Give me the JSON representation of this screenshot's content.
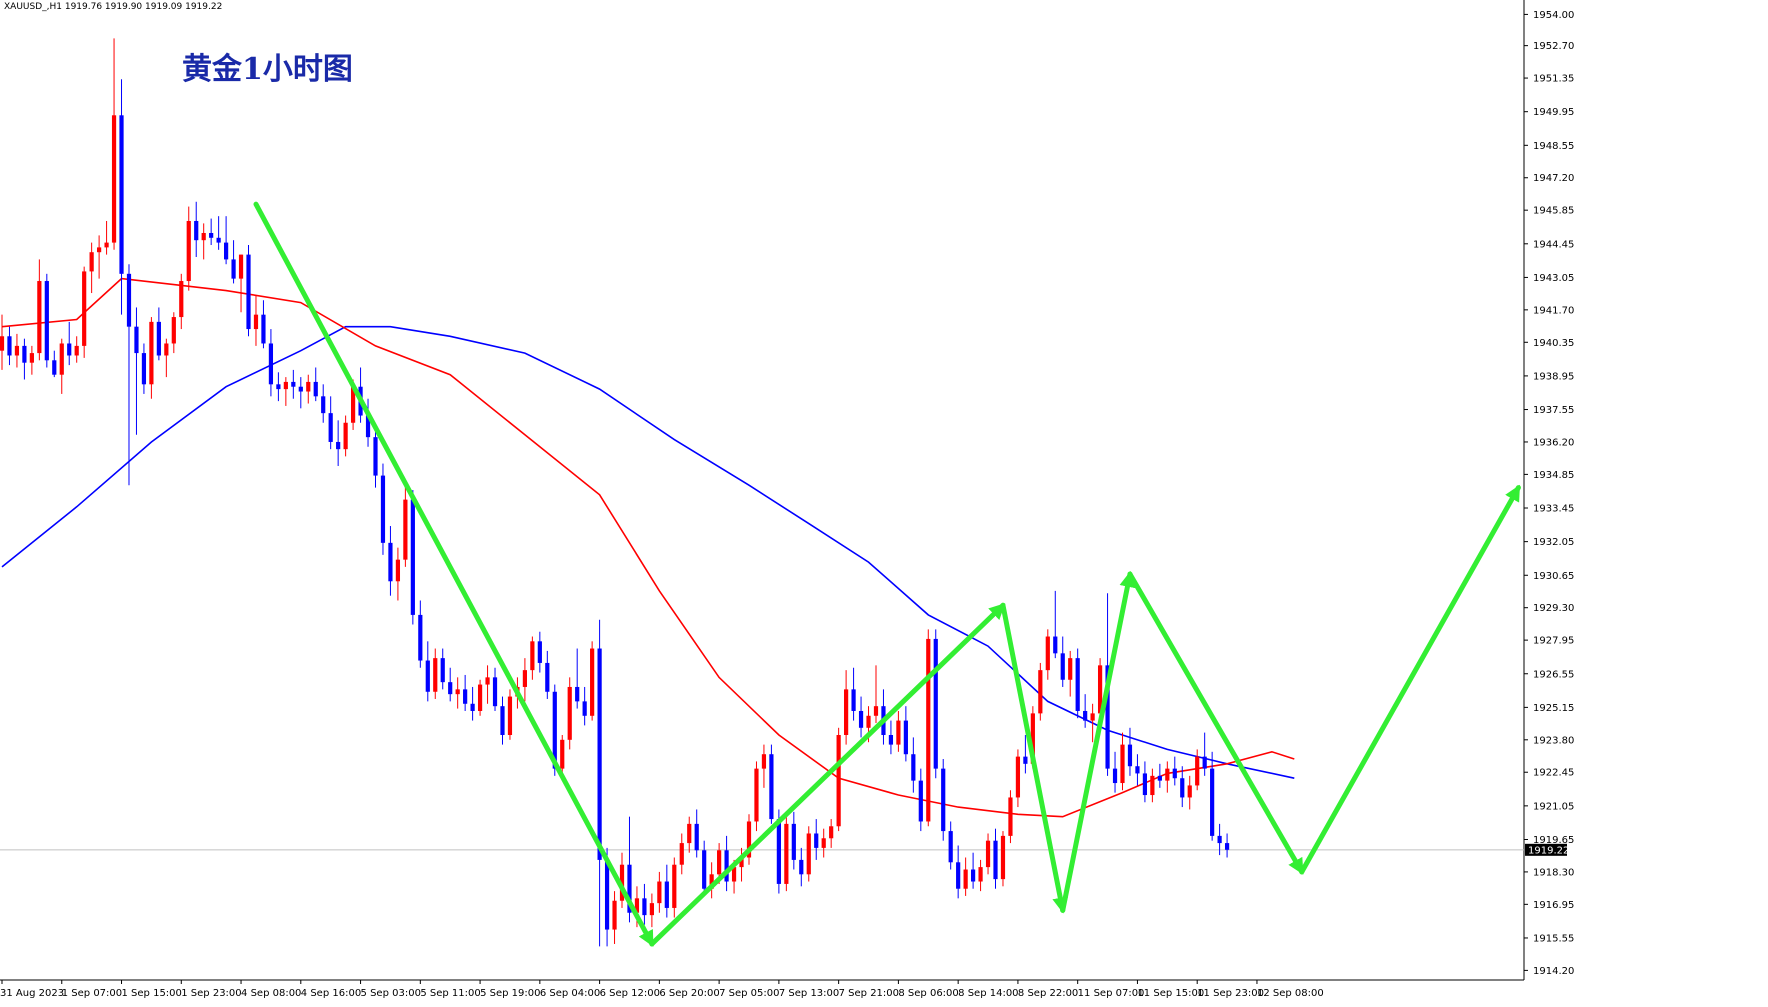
{
  "header": {
    "symbol_info": "XAUUSD_,H1  1919.76 1919.90 1919.09 1919.22"
  },
  "title": "黄金1小时图",
  "colors": {
    "bull": "#ff0000",
    "bear": "#0000ff",
    "ma_fast": "#ff0000",
    "ma_slow": "#0000ff",
    "arrows": "#33ee33",
    "price_line": "#c0c0c0",
    "title": "#1a2aa8"
  },
  "current_price_label": "1919.22",
  "chart_data": {
    "type": "candlestick",
    "symbol": "XAUUSD_",
    "timeframe": "H1",
    "ylim": [
      1913.8,
      1954.6
    ],
    "current_price": 1919.22,
    "y_ticks": [
      "1954.00",
      "1952.70",
      "1951.35",
      "1949.95",
      "1948.55",
      "1947.20",
      "1945.85",
      "1944.45",
      "1943.05",
      "1941.70",
      "1940.35",
      "1938.95",
      "1937.55",
      "1936.20",
      "1934.85",
      "1933.45",
      "1932.05",
      "1930.65",
      "1929.30",
      "1927.95",
      "1926.55",
      "1925.15",
      "1923.80",
      "1922.45",
      "1921.05",
      "1919.65",
      "1918.30",
      "1916.95",
      "1915.55",
      "1914.20"
    ],
    "x_ticks": [
      {
        "label": "31 Aug 2023",
        "index": 0
      },
      {
        "label": "1 Sep 07:00",
        "index": 8
      },
      {
        "label": "1 Sep 15:00",
        "index": 16
      },
      {
        "label": "1 Sep 23:00",
        "index": 24
      },
      {
        "label": "4 Sep 08:00",
        "index": 32
      },
      {
        "label": "4 Sep 16:00",
        "index": 40
      },
      {
        "label": "5 Sep 03:00",
        "index": 48
      },
      {
        "label": "5 Sep 11:00",
        "index": 56
      },
      {
        "label": "5 Sep 19:00",
        "index": 64
      },
      {
        "label": "6 Sep 04:00",
        "index": 72
      },
      {
        "label": "6 Sep 12:00",
        "index": 80
      },
      {
        "label": "6 Sep 20:00",
        "index": 88
      },
      {
        "label": "7 Sep 05:00",
        "index": 96
      },
      {
        "label": "7 Sep 13:00",
        "index": 104
      },
      {
        "label": "7 Sep 21:00",
        "index": 112
      },
      {
        "label": "8 Sep 06:00",
        "index": 120
      },
      {
        "label": "8 Sep 14:00",
        "index": 128
      },
      {
        "label": "8 Sep 22:00",
        "index": 136
      },
      {
        "label": "11 Sep 07:00",
        "index": 144
      },
      {
        "label": "11 Sep 15:00",
        "index": 152
      },
      {
        "label": "11 Sep 23:00",
        "index": 160
      },
      {
        "label": "12 Sep 08:00",
        "index": 168
      }
    ],
    "ohlc": [
      [
        1940.0,
        1941.5,
        1939.2,
        1940.6
      ],
      [
        1940.6,
        1941.0,
        1939.4,
        1939.8
      ],
      [
        1939.8,
        1940.7,
        1939.3,
        1940.2
      ],
      [
        1940.2,
        1940.5,
        1938.8,
        1939.5
      ],
      [
        1939.5,
        1940.2,
        1939.0,
        1939.9
      ],
      [
        1939.9,
        1943.8,
        1939.6,
        1942.9
      ],
      [
        1942.9,
        1943.2,
        1939.3,
        1939.6
      ],
      [
        1939.6,
        1940.0,
        1938.9,
        1939.0
      ],
      [
        1939.0,
        1940.5,
        1938.2,
        1940.3
      ],
      [
        1940.3,
        1941.2,
        1939.4,
        1939.8
      ],
      [
        1939.8,
        1940.6,
        1939.5,
        1940.2
      ],
      [
        1940.2,
        1943.5,
        1939.7,
        1943.3
      ],
      [
        1943.3,
        1944.5,
        1942.4,
        1944.1
      ],
      [
        1944.1,
        1944.8,
        1943.0,
        1944.3
      ],
      [
        1944.3,
        1945.4,
        1944.0,
        1944.5
      ],
      [
        1944.5,
        1953.0,
        1944.2,
        1949.8
      ],
      [
        1949.8,
        1951.3,
        1941.5,
        1943.2
      ],
      [
        1943.2,
        1943.6,
        1934.4,
        1941.0
      ],
      [
        1941.0,
        1941.8,
        1936.5,
        1939.9
      ],
      [
        1939.9,
        1940.3,
        1938.2,
        1938.6
      ],
      [
        1938.6,
        1941.4,
        1938.0,
        1941.2
      ],
      [
        1941.2,
        1941.8,
        1939.6,
        1939.8
      ],
      [
        1939.8,
        1940.5,
        1938.9,
        1940.3
      ],
      [
        1940.3,
        1941.6,
        1939.9,
        1941.4
      ],
      [
        1941.4,
        1943.2,
        1940.9,
        1942.9
      ],
      [
        1942.9,
        1946.0,
        1942.5,
        1945.4
      ],
      [
        1945.4,
        1946.2,
        1943.9,
        1944.6
      ],
      [
        1944.6,
        1945.3,
        1943.8,
        1944.9
      ],
      [
        1944.9,
        1945.5,
        1944.4,
        1944.7
      ],
      [
        1944.7,
        1945.6,
        1944.2,
        1944.5
      ],
      [
        1944.5,
        1945.6,
        1943.6,
        1943.8
      ],
      [
        1943.8,
        1944.6,
        1942.8,
        1943.0
      ],
      [
        1943.0,
        1944.0,
        1941.6,
        1944.0
      ],
      [
        1944.0,
        1944.4,
        1940.6,
        1940.9
      ],
      [
        1940.9,
        1942.3,
        1940.2,
        1941.5
      ],
      [
        1941.5,
        1942.1,
        1940.1,
        1940.3
      ],
      [
        1940.3,
        1940.9,
        1938.1,
        1938.6
      ],
      [
        1938.6,
        1939.1,
        1937.9,
        1938.4
      ],
      [
        1938.4,
        1938.9,
        1937.7,
        1938.7
      ],
      [
        1938.7,
        1939.2,
        1938.0,
        1938.5
      ],
      [
        1938.5,
        1938.9,
        1937.6,
        1938.3
      ],
      [
        1938.3,
        1939.0,
        1937.8,
        1938.7
      ],
      [
        1938.7,
        1939.3,
        1937.9,
        1938.1
      ],
      [
        1938.1,
        1938.6,
        1937.0,
        1937.4
      ],
      [
        1937.4,
        1938.1,
        1935.9,
        1936.2
      ],
      [
        1936.2,
        1937.1,
        1935.2,
        1935.9
      ],
      [
        1935.9,
        1937.3,
        1935.6,
        1937.0
      ],
      [
        1937.0,
        1938.8,
        1936.7,
        1938.5
      ],
      [
        1938.5,
        1939.3,
        1937.0,
        1937.3
      ],
      [
        1937.3,
        1938.0,
        1936.0,
        1936.4
      ],
      [
        1936.4,
        1936.9,
        1934.3,
        1934.8
      ],
      [
        1934.8,
        1935.3,
        1931.5,
        1932.0
      ],
      [
        1932.0,
        1932.7,
        1929.8,
        1930.4
      ],
      [
        1930.4,
        1931.8,
        1929.6,
        1931.3
      ],
      [
        1931.3,
        1934.4,
        1931.0,
        1933.8
      ],
      [
        1933.8,
        1934.2,
        1928.6,
        1929.0
      ],
      [
        1929.0,
        1929.6,
        1926.8,
        1927.1
      ],
      [
        1927.1,
        1927.9,
        1925.4,
        1925.8
      ],
      [
        1925.8,
        1927.6,
        1925.5,
        1927.2
      ],
      [
        1927.2,
        1927.6,
        1925.9,
        1926.2
      ],
      [
        1926.2,
        1926.8,
        1925.4,
        1925.7
      ],
      [
        1925.7,
        1926.4,
        1925.1,
        1925.9
      ],
      [
        1925.9,
        1926.5,
        1925.0,
        1925.3
      ],
      [
        1925.3,
        1926.0,
        1924.6,
        1925.0
      ],
      [
        1925.0,
        1926.3,
        1924.8,
        1926.1
      ],
      [
        1926.1,
        1926.9,
        1925.3,
        1926.4
      ],
      [
        1926.4,
        1926.8,
        1925.0,
        1925.2
      ],
      [
        1925.2,
        1925.6,
        1923.6,
        1924.0
      ],
      [
        1924.0,
        1925.9,
        1923.8,
        1925.6
      ],
      [
        1925.6,
        1926.4,
        1925.1,
        1926.0
      ],
      [
        1926.0,
        1927.2,
        1925.4,
        1926.7
      ],
      [
        1926.7,
        1928.1,
        1926.3,
        1927.9
      ],
      [
        1927.9,
        1928.3,
        1926.6,
        1927.0
      ],
      [
        1927.0,
        1927.5,
        1925.5,
        1925.8
      ],
      [
        1925.8,
        1926.1,
        1922.3,
        1922.6
      ],
      [
        1922.6,
        1924.0,
        1922.1,
        1923.8
      ],
      [
        1923.8,
        1926.4,
        1923.4,
        1926.0
      ],
      [
        1926.0,
        1927.6,
        1925.1,
        1925.4
      ],
      [
        1925.4,
        1926.0,
        1924.4,
        1924.8
      ],
      [
        1924.8,
        1927.9,
        1924.6,
        1927.6
      ],
      [
        1927.6,
        1928.8,
        1915.2,
        1918.8
      ],
      [
        1918.8,
        1919.3,
        1915.2,
        1915.9
      ],
      [
        1915.9,
        1917.5,
        1915.3,
        1917.1
      ],
      [
        1917.1,
        1919.1,
        1916.8,
        1918.6
      ],
      [
        1918.6,
        1920.6,
        1916.2,
        1916.6
      ],
      [
        1916.6,
        1917.7,
        1916.0,
        1917.2
      ],
      [
        1917.2,
        1917.8,
        1916.1,
        1916.5
      ],
      [
        1916.5,
        1917.4,
        1916.0,
        1917.0
      ],
      [
        1917.0,
        1918.3,
        1916.6,
        1917.9
      ],
      [
        1917.9,
        1918.6,
        1916.4,
        1916.8
      ],
      [
        1916.8,
        1918.9,
        1916.4,
        1918.6
      ],
      [
        1918.6,
        1919.9,
        1918.2,
        1919.5
      ],
      [
        1919.5,
        1920.6,
        1919.1,
        1920.3
      ],
      [
        1920.3,
        1920.9,
        1918.9,
        1919.2
      ],
      [
        1919.2,
        1919.6,
        1917.3,
        1917.6
      ],
      [
        1917.6,
        1918.7,
        1917.2,
        1918.2
      ],
      [
        1918.2,
        1919.5,
        1917.8,
        1919.2
      ],
      [
        1919.2,
        1919.8,
        1917.5,
        1917.9
      ],
      [
        1917.9,
        1918.8,
        1917.4,
        1918.5
      ],
      [
        1918.5,
        1919.3,
        1917.9,
        1918.9
      ],
      [
        1918.9,
        1920.7,
        1918.6,
        1920.4
      ],
      [
        1920.4,
        1922.9,
        1920.0,
        1922.6
      ],
      [
        1922.6,
        1923.6,
        1921.8,
        1923.2
      ],
      [
        1923.2,
        1923.6,
        1920.3,
        1920.5
      ],
      [
        1920.5,
        1920.9,
        1917.4,
        1917.8
      ],
      [
        1917.8,
        1920.6,
        1917.5,
        1920.3
      ],
      [
        1920.3,
        1920.8,
        1918.4,
        1918.8
      ],
      [
        1918.8,
        1919.3,
        1917.7,
        1918.2
      ],
      [
        1918.2,
        1920.2,
        1917.9,
        1919.9
      ],
      [
        1919.9,
        1920.5,
        1918.8,
        1919.3
      ],
      [
        1919.3,
        1920.1,
        1918.9,
        1919.7
      ],
      [
        1919.7,
        1920.5,
        1919.3,
        1920.2
      ],
      [
        1920.2,
        1924.3,
        1920.0,
        1924.0
      ],
      [
        1924.0,
        1926.7,
        1923.6,
        1925.9
      ],
      [
        1925.9,
        1926.8,
        1924.6,
        1925.0
      ],
      [
        1925.0,
        1925.6,
        1923.9,
        1924.3
      ],
      [
        1924.3,
        1925.2,
        1923.7,
        1924.8
      ],
      [
        1924.8,
        1926.9,
        1924.5,
        1925.2
      ],
      [
        1925.2,
        1925.9,
        1923.6,
        1924.0
      ],
      [
        1924.0,
        1924.6,
        1923.2,
        1923.6
      ],
      [
        1923.6,
        1925.0,
        1923.3,
        1924.6
      ],
      [
        1924.6,
        1925.2,
        1922.9,
        1923.2
      ],
      [
        1923.2,
        1923.9,
        1921.6,
        1922.1
      ],
      [
        1922.1,
        1922.6,
        1920.0,
        1920.4
      ],
      [
        1920.4,
        1928.4,
        1920.2,
        1928.0
      ],
      [
        1928.0,
        1928.4,
        1922.2,
        1922.6
      ],
      [
        1922.6,
        1923.0,
        1919.6,
        1920.0
      ],
      [
        1920.0,
        1920.4,
        1918.4,
        1918.7
      ],
      [
        1918.7,
        1919.4,
        1917.2,
        1917.6
      ],
      [
        1917.6,
        1918.9,
        1917.3,
        1918.4
      ],
      [
        1918.4,
        1919.1,
        1917.6,
        1917.9
      ],
      [
        1917.9,
        1918.8,
        1917.5,
        1918.5
      ],
      [
        1918.5,
        1919.9,
        1918.2,
        1919.6
      ],
      [
        1919.6,
        1920.1,
        1917.6,
        1918.0
      ],
      [
        1918.0,
        1920.0,
        1917.7,
        1919.8
      ],
      [
        1919.8,
        1921.7,
        1919.5,
        1921.4
      ],
      [
        1921.4,
        1923.4,
        1921.0,
        1923.1
      ],
      [
        1923.1,
        1924.0,
        1922.4,
        1922.8
      ],
      [
        1922.8,
        1925.2,
        1922.6,
        1924.9
      ],
      [
        1924.9,
        1927.0,
        1924.6,
        1926.7
      ],
      [
        1926.7,
        1928.4,
        1926.3,
        1928.1
      ],
      [
        1928.1,
        1930.0,
        1927.2,
        1927.4
      ],
      [
        1927.4,
        1928.1,
        1926.0,
        1926.3
      ],
      [
        1926.3,
        1927.5,
        1925.6,
        1927.2
      ],
      [
        1927.2,
        1927.6,
        1924.7,
        1925.0
      ],
      [
        1925.0,
        1925.7,
        1924.3,
        1924.6
      ],
      [
        1924.6,
        1925.3,
        1923.7,
        1924.9
      ],
      [
        1924.9,
        1927.2,
        1924.6,
        1926.9
      ],
      [
        1926.9,
        1929.9,
        1922.3,
        1922.6
      ],
      [
        1922.6,
        1923.3,
        1921.6,
        1922.0
      ],
      [
        1922.0,
        1924.1,
        1921.7,
        1923.6
      ],
      [
        1923.6,
        1924.3,
        1922.3,
        1922.7
      ],
      [
        1922.7,
        1923.2,
        1921.9,
        1922.4
      ],
      [
        1922.4,
        1922.9,
        1921.2,
        1921.5
      ],
      [
        1921.5,
        1922.6,
        1921.2,
        1922.3
      ],
      [
        1922.3,
        1922.8,
        1921.8,
        1922.1
      ],
      [
        1922.1,
        1922.9,
        1921.6,
        1922.6
      ],
      [
        1922.6,
        1923.1,
        1921.9,
        1922.2
      ],
      [
        1922.2,
        1922.7,
        1921.0,
        1921.4
      ],
      [
        1921.4,
        1922.3,
        1920.9,
        1921.9
      ],
      [
        1921.9,
        1923.4,
        1921.7,
        1923.1
      ],
      [
        1923.1,
        1924.1,
        1922.3,
        1922.6
      ],
      [
        1922.6,
        1923.3,
        1919.6,
        1919.8
      ],
      [
        1919.8,
        1920.3,
        1919.0,
        1919.5
      ],
      [
        1919.5,
        1919.9,
        1918.9,
        1919.22
      ]
    ],
    "ma_fast": [
      [
        0,
        1941.0
      ],
      [
        10,
        1941.3
      ],
      [
        16,
        1943.0
      ],
      [
        30,
        1942.5
      ],
      [
        40,
        1942.0
      ],
      [
        50,
        1940.2
      ],
      [
        60,
        1939.0
      ],
      [
        70,
        1936.5
      ],
      [
        80,
        1934.0
      ],
      [
        88,
        1930.0
      ],
      [
        96,
        1926.4
      ],
      [
        104,
        1924.0
      ],
      [
        112,
        1922.2
      ],
      [
        120,
        1921.5
      ],
      [
        128,
        1921.0
      ],
      [
        136,
        1920.7
      ],
      [
        142,
        1920.6
      ],
      [
        150,
        1921.6
      ],
      [
        156,
        1922.4
      ],
      [
        164,
        1922.8
      ],
      [
        170,
        1923.3
      ],
      [
        173,
        1923.0
      ]
    ],
    "ma_slow": [
      [
        0,
        1931.0
      ],
      [
        10,
        1933.5
      ],
      [
        20,
        1936.2
      ],
      [
        30,
        1938.5
      ],
      [
        40,
        1940.0
      ],
      [
        46,
        1941.0
      ],
      [
        52,
        1941.0
      ],
      [
        60,
        1940.6
      ],
      [
        70,
        1939.9
      ],
      [
        80,
        1938.4
      ],
      [
        90,
        1936.3
      ],
      [
        100,
        1934.4
      ],
      [
        108,
        1932.8
      ],
      [
        116,
        1931.2
      ],
      [
        124,
        1929.0
      ],
      [
        132,
        1927.7
      ],
      [
        140,
        1925.4
      ],
      [
        148,
        1924.2
      ],
      [
        156,
        1923.4
      ],
      [
        164,
        1922.8
      ],
      [
        173,
        1922.2
      ]
    ],
    "arrows": [
      {
        "from": [
          34,
          1946.1
        ],
        "to": [
          87,
          1915.3
        ]
      },
      {
        "from": [
          87,
          1915.3
        ],
        "to": [
          134,
          1929.4
        ]
      },
      {
        "from": [
          134,
          1929.4
        ],
        "to": [
          142,
          1916.7
        ]
      },
      {
        "from": [
          142,
          1916.7
        ],
        "to": [
          151,
          1930.7
        ]
      },
      {
        "from": [
          151,
          1930.7
        ],
        "to": [
          174,
          1918.3
        ]
      },
      {
        "from": [
          174,
          1918.3
        ],
        "to": [
          203,
          1934.3
        ]
      }
    ]
  }
}
